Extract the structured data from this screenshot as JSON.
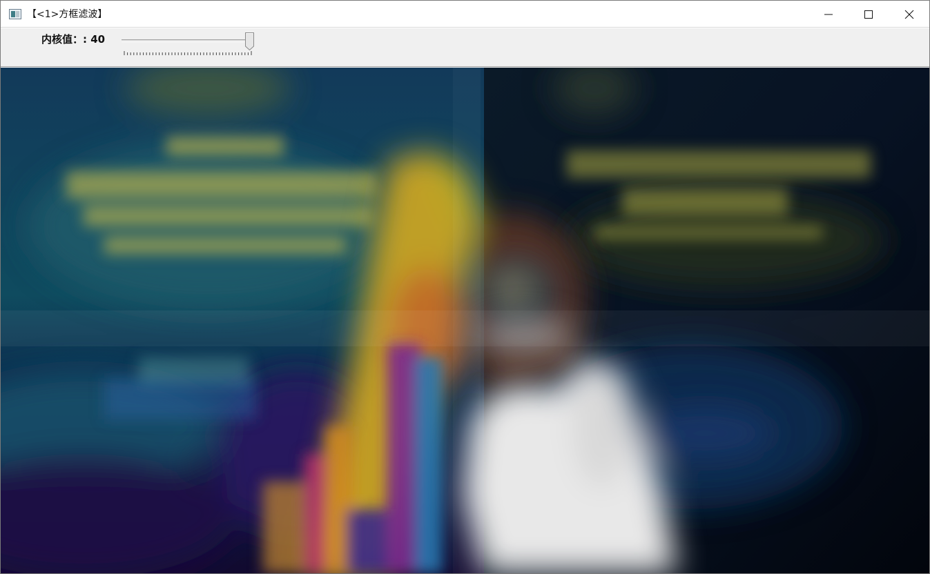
{
  "window": {
    "title": "【<1>方框滤波】",
    "buttons": {
      "minimize_icon": "minimize-icon",
      "maximize_icon": "maximize-icon",
      "close_icon": "close-icon"
    }
  },
  "trackbar": {
    "label": "内核值：: 40",
    "value": 40,
    "max": 40
  },
  "image": {
    "description_icon": "blurred-image",
    "filter": "box-blur"
  },
  "colors": {
    "titlebar_bg": "#ffffff",
    "toolbar_bg": "#f0f0f0",
    "image_dark_bg": "#06101c"
  }
}
